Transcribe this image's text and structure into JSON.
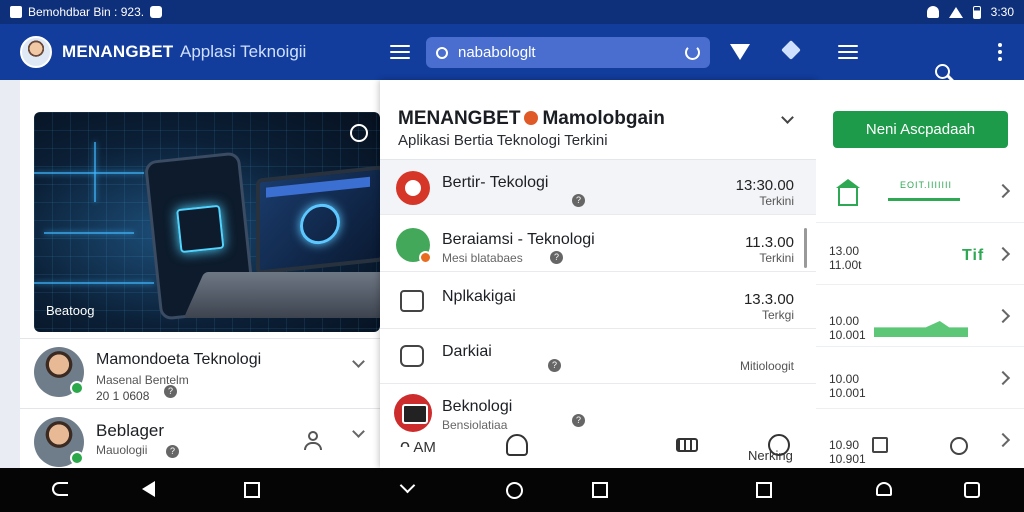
{
  "status_bar": {
    "app_label": "Bemohdbar Bin : 923.",
    "time": "3:30",
    "icons": [
      "app-icon",
      "notification-icon",
      "wifi-icon",
      "signal-icon",
      "battery-icon"
    ]
  },
  "app_bar": {
    "brand": "MENANGBET",
    "tagline": "Applasi Teknoigii",
    "search_value": "nababologlt"
  },
  "left_panel": {
    "hero_caption": "Beatoog",
    "cards": [
      {
        "title": "Mamondoeta Teknologi",
        "subtitle": "Masenal Bentelm",
        "meta": "20 1 0608"
      },
      {
        "title": "Beblager",
        "subtitle": "Mauologii"
      }
    ]
  },
  "dropdown": {
    "title_left": "MENANGBET",
    "title_right": "Mamolobgain",
    "subtitle": "Aplikasi Bertia Teknologi Terkini",
    "rows": [
      {
        "title": "Bertir- Tekologi",
        "subtitle": "",
        "time": "13:30.00",
        "tag": "Terkini"
      },
      {
        "title": "Beraiamsi - Teknologi",
        "subtitle": "Mesi blatabaes",
        "time": "11.3.00",
        "tag": "Terkini"
      },
      {
        "title": "Nplkakigai",
        "subtitle": "",
        "time": "13.3.00",
        "tag": "Terkgi"
      },
      {
        "title": "Darkiai",
        "subtitle": "",
        "time": "",
        "tag": "Mitioloogit"
      },
      {
        "title": "Beknologi",
        "subtitle": "Bensiolatiaa",
        "time": "",
        "tag": ""
      }
    ],
    "bottom_bar": {
      "left_label": "AM",
      "right_label": "Nerking"
    }
  },
  "right_panel": {
    "cta_label": "Neni Ascpadaah",
    "graph_label": "EOIT.IIIIIII",
    "rows": [
      {
        "line1": "",
        "line2": ""
      },
      {
        "line1": "13.00",
        "line2": "11.00t"
      },
      {
        "line1": "10.00",
        "line2": "10.001"
      },
      {
        "line1": "10.00",
        "line2": "10.001"
      },
      {
        "line1": "10.90",
        "line2": "10.901"
      }
    ]
  },
  "colors": {
    "app_bar": "#123d9c",
    "status_bar": "#0e2f7a",
    "accent_green": "#1e9b4a",
    "accent_red": "#d63628"
  }
}
